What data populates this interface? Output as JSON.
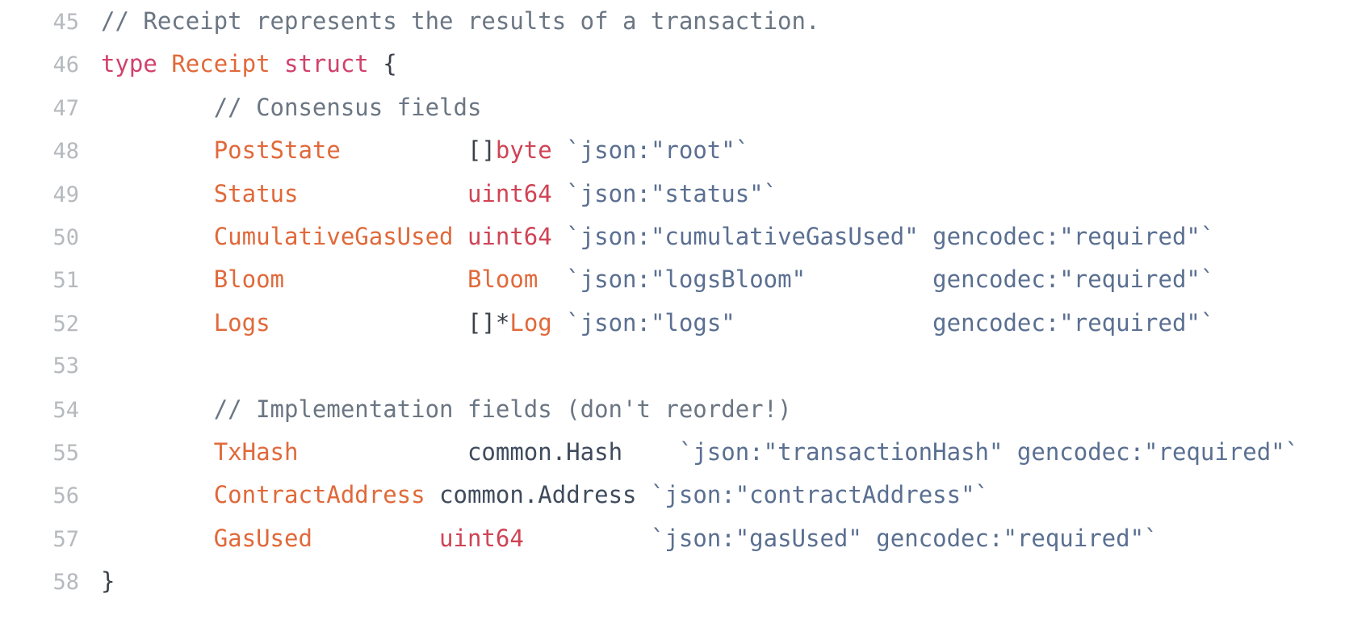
{
  "editor": {
    "language": "Go",
    "background_color": "#ffffff",
    "gutter_color": "#b6b9bd",
    "first_line_number": 45,
    "last_line_number": 58,
    "colors": {
      "comment": "#6b7683",
      "keyword": "#d1416b",
      "builtin_type": "#cf4455",
      "identifier": "#e0693a",
      "custom_type": "#e0693a",
      "struct_tag_string": "#5a6f91",
      "punctuation": "#3b4049",
      "qualified_type": "#3f4b5c"
    }
  },
  "lines": [
    {
      "number": "45",
      "text": "// Receipt represents the results of a transaction.",
      "tokens": [
        {
          "t": "// Receipt represents the results of a transaction.",
          "c": "tok-comment"
        }
      ]
    },
    {
      "number": "46",
      "text": "type Receipt struct {",
      "tokens": [
        {
          "t": "type",
          "c": "tok-keyword"
        },
        {
          "t": " ",
          "c": "tok-plain"
        },
        {
          "t": "Receipt",
          "c": "tok-custom"
        },
        {
          "t": " ",
          "c": "tok-plain"
        },
        {
          "t": "struct",
          "c": "tok-keyword"
        },
        {
          "t": " ",
          "c": "tok-plain"
        },
        {
          "t": "{",
          "c": "tok-punct"
        }
      ]
    },
    {
      "number": "47",
      "text": "        // Consensus fields",
      "tokens": [
        {
          "t": "        ",
          "c": "tok-plain"
        },
        {
          "t": "// Consensus fields",
          "c": "tok-comment"
        }
      ]
    },
    {
      "number": "48",
      "text": "        PostState         []byte `json:\"root\"`",
      "tokens": [
        {
          "t": "        ",
          "c": "tok-plain"
        },
        {
          "t": "PostState",
          "c": "tok-ident"
        },
        {
          "t": "         ",
          "c": "tok-plain"
        },
        {
          "t": "[]",
          "c": "tok-punct"
        },
        {
          "t": "byte",
          "c": "tok-type"
        },
        {
          "t": " ",
          "c": "tok-plain"
        },
        {
          "t": "`json:\"root\"`",
          "c": "tok-string"
        }
      ]
    },
    {
      "number": "49",
      "text": "        Status            uint64 `json:\"status\"`",
      "tokens": [
        {
          "t": "        ",
          "c": "tok-plain"
        },
        {
          "t": "Status",
          "c": "tok-ident"
        },
        {
          "t": "            ",
          "c": "tok-plain"
        },
        {
          "t": "uint64",
          "c": "tok-type"
        },
        {
          "t": " ",
          "c": "tok-plain"
        },
        {
          "t": "`json:\"status\"`",
          "c": "tok-string"
        }
      ]
    },
    {
      "number": "50",
      "text": "        CumulativeGasUsed uint64 `json:\"cumulativeGasUsed\" gencodec:\"required\"`",
      "tokens": [
        {
          "t": "        ",
          "c": "tok-plain"
        },
        {
          "t": "CumulativeGasUsed",
          "c": "tok-ident"
        },
        {
          "t": " ",
          "c": "tok-plain"
        },
        {
          "t": "uint64",
          "c": "tok-type"
        },
        {
          "t": " ",
          "c": "tok-plain"
        },
        {
          "t": "`json:\"cumulativeGasUsed\" gencodec:\"required\"`",
          "c": "tok-string"
        }
      ]
    },
    {
      "number": "51",
      "text": "        Bloom             Bloom  `json:\"logsBloom\"         gencodec:\"required\"`",
      "tokens": [
        {
          "t": "        ",
          "c": "tok-plain"
        },
        {
          "t": "Bloom",
          "c": "tok-ident"
        },
        {
          "t": "             ",
          "c": "tok-plain"
        },
        {
          "t": "Bloom",
          "c": "tok-custom"
        },
        {
          "t": "  ",
          "c": "tok-plain"
        },
        {
          "t": "`json:\"logsBloom\"         gencodec:\"required\"`",
          "c": "tok-string"
        }
      ]
    },
    {
      "number": "52",
      "text": "        Logs              []*Log `json:\"logs\"              gencodec:\"required\"`",
      "tokens": [
        {
          "t": "        ",
          "c": "tok-plain"
        },
        {
          "t": "Logs",
          "c": "tok-ident"
        },
        {
          "t": "              ",
          "c": "tok-plain"
        },
        {
          "t": "[]*",
          "c": "tok-punct"
        },
        {
          "t": "Log",
          "c": "tok-custom"
        },
        {
          "t": " ",
          "c": "tok-plain"
        },
        {
          "t": "`json:\"logs\"              gencodec:\"required\"`",
          "c": "tok-string"
        }
      ]
    },
    {
      "number": "53",
      "text": "",
      "tokens": []
    },
    {
      "number": "54",
      "text": "        // Implementation fields (don't reorder!)",
      "tokens": [
        {
          "t": "        ",
          "c": "tok-plain"
        },
        {
          "t": "// Implementation fields (don't reorder!)",
          "c": "tok-comment"
        }
      ]
    },
    {
      "number": "55",
      "text": "        TxHash            common.Hash    `json:\"transactionHash\" gencodec:\"required\"`",
      "tokens": [
        {
          "t": "        ",
          "c": "tok-plain"
        },
        {
          "t": "TxHash",
          "c": "tok-ident"
        },
        {
          "t": "            ",
          "c": "tok-plain"
        },
        {
          "t": "common.Hash",
          "c": "tok-qual"
        },
        {
          "t": "    ",
          "c": "tok-plain"
        },
        {
          "t": "`json:\"transactionHash\" gencodec:\"required\"`",
          "c": "tok-string"
        }
      ]
    },
    {
      "number": "56",
      "text": "        ContractAddress common.Address `json:\"contractAddress\"`",
      "tokens": [
        {
          "t": "        ",
          "c": "tok-plain"
        },
        {
          "t": "ContractAddress",
          "c": "tok-ident"
        },
        {
          "t": " ",
          "c": "tok-plain"
        },
        {
          "t": "common.Address",
          "c": "tok-qual"
        },
        {
          "t": " ",
          "c": "tok-plain"
        },
        {
          "t": "`json:\"contractAddress\"`",
          "c": "tok-string"
        }
      ]
    },
    {
      "number": "57",
      "text": "        GasUsed         uint64         `json:\"gasUsed\" gencodec:\"required\"`",
      "tokens": [
        {
          "t": "        ",
          "c": "tok-plain"
        },
        {
          "t": "GasUsed",
          "c": "tok-ident"
        },
        {
          "t": "         ",
          "c": "tok-plain"
        },
        {
          "t": "uint64",
          "c": "tok-type"
        },
        {
          "t": "         ",
          "c": "tok-plain"
        },
        {
          "t": "`json:\"gasUsed\" gencodec:\"required\"`",
          "c": "tok-string"
        }
      ]
    },
    {
      "number": "58",
      "text": "}",
      "tokens": [
        {
          "t": "}",
          "c": "tok-punct"
        }
      ]
    }
  ]
}
